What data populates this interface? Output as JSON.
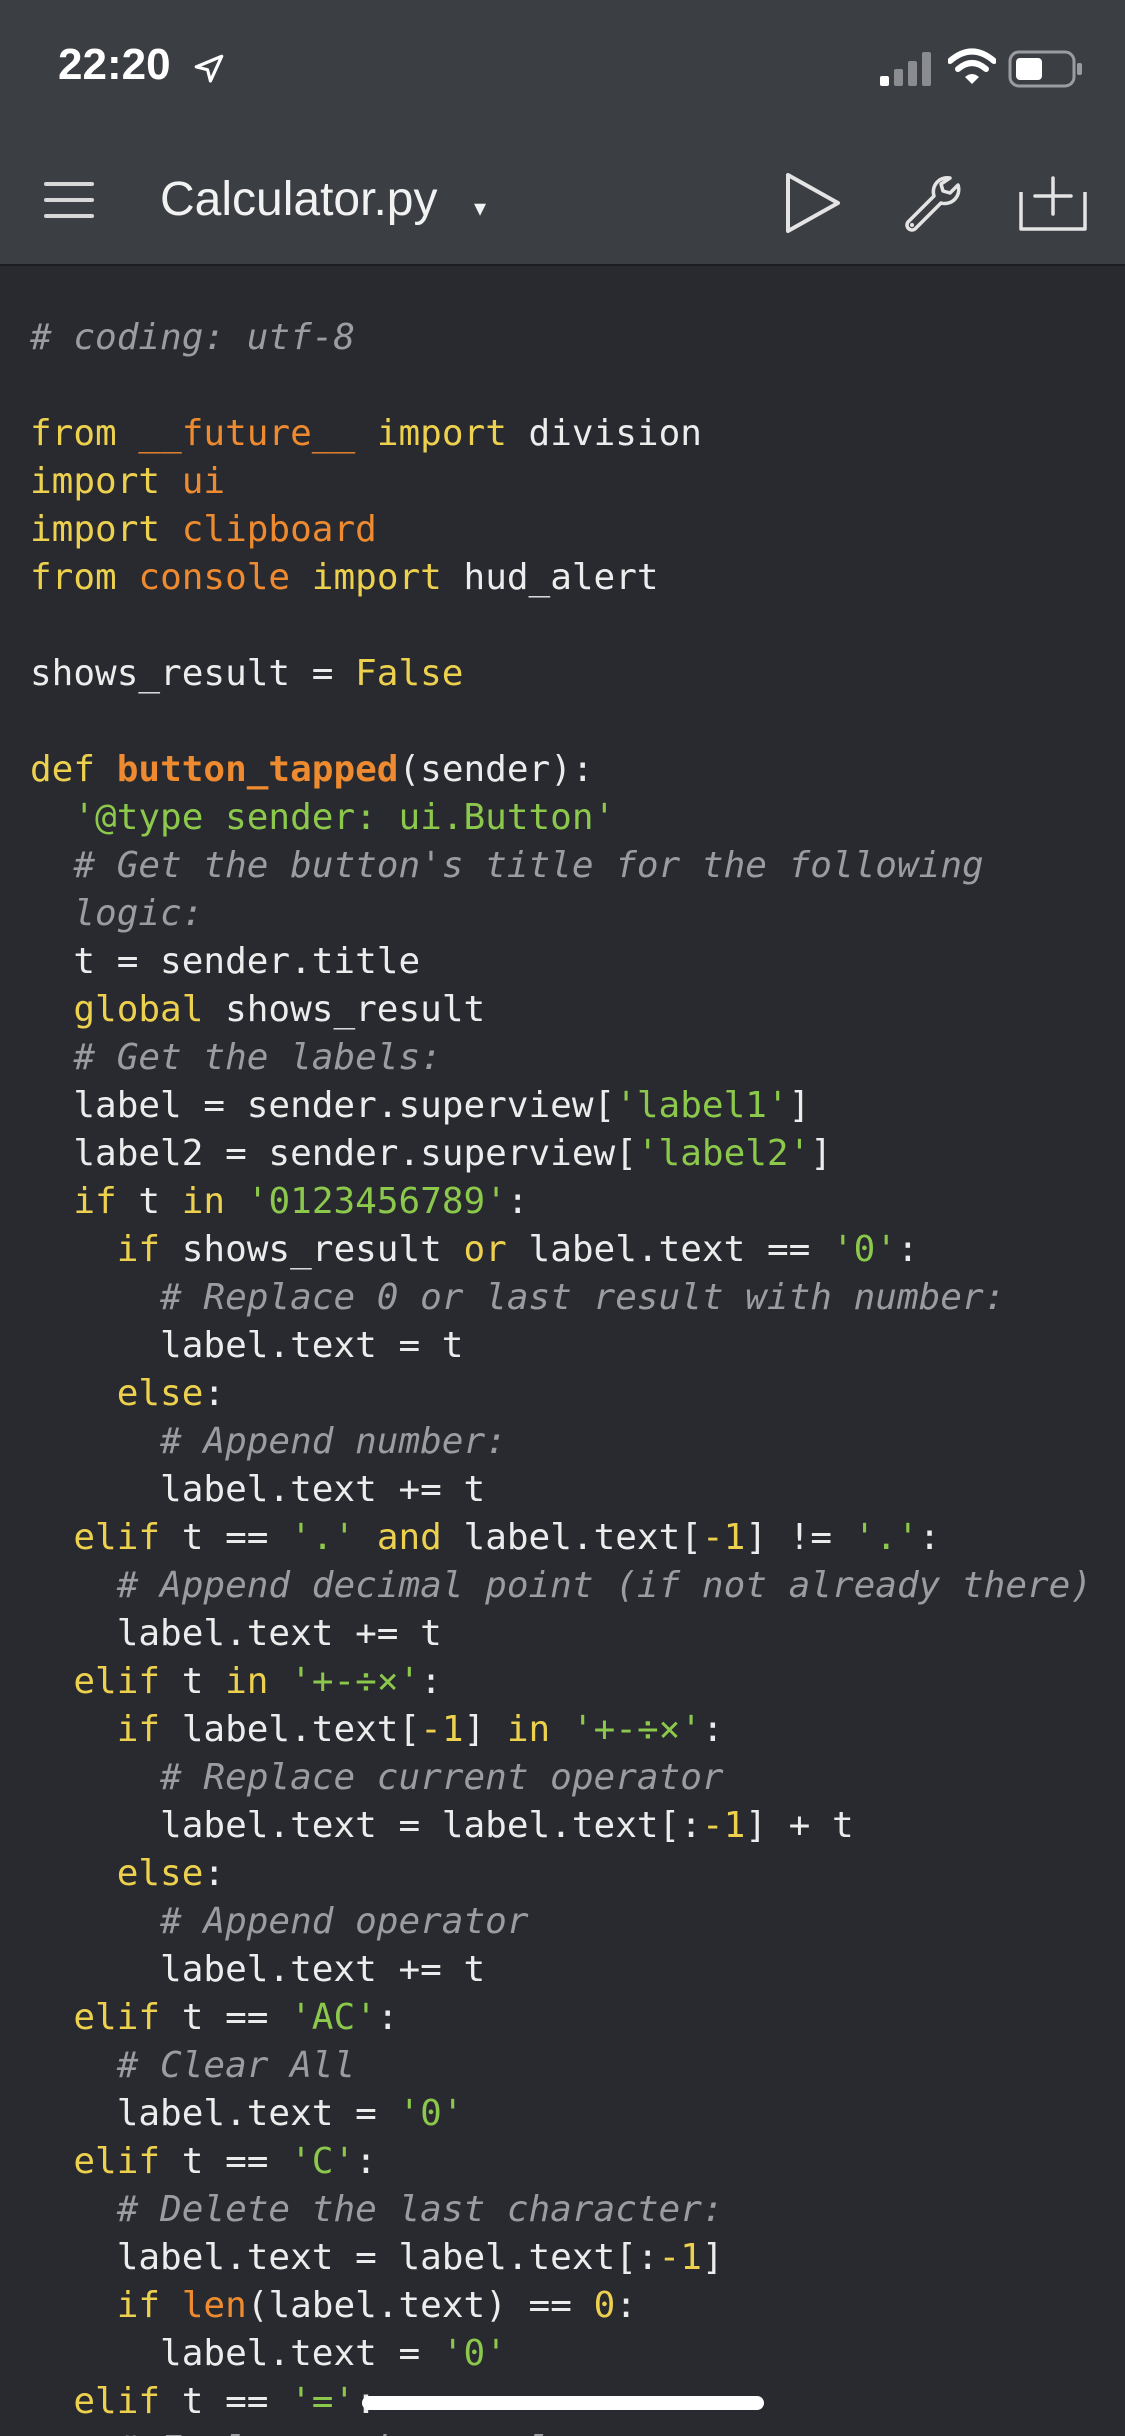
{
  "status_bar": {
    "time": "22:20",
    "icons": [
      "location-arrow-icon",
      "cellular-signal-icon",
      "wifi-icon",
      "battery-icon"
    ]
  },
  "nav_bar": {
    "title": "Calculator.py",
    "title_caret": "▾",
    "buttons": [
      "menu-icon",
      "play-icon",
      "wrench-icon",
      "add-file-icon"
    ]
  },
  "colors": {
    "background": "#282a2f",
    "bar": "#3b3e43",
    "keyword": "#ecd04e",
    "module": "#ee8a2f",
    "string": "#8cc84b",
    "comment": "#9a9ca2",
    "text": "#ececec"
  },
  "code": {
    "language": "python",
    "lines": [
      [
        [
          "c",
          "# coding: utf-8"
        ]
      ],
      [],
      [
        [
          "k",
          "from"
        ],
        [
          "t",
          " "
        ],
        [
          "m",
          "__future__"
        ],
        [
          "t",
          " "
        ],
        [
          "k",
          "import"
        ],
        [
          "t",
          " division"
        ]
      ],
      [
        [
          "k",
          "import"
        ],
        [
          "t",
          " "
        ],
        [
          "m",
          "ui"
        ]
      ],
      [
        [
          "k",
          "import"
        ],
        [
          "t",
          " "
        ],
        [
          "m",
          "clipboard"
        ]
      ],
      [
        [
          "k",
          "from"
        ],
        [
          "t",
          " "
        ],
        [
          "m",
          "console"
        ],
        [
          "t",
          " "
        ],
        [
          "k",
          "import"
        ],
        [
          "t",
          " hud_alert"
        ]
      ],
      [],
      [
        [
          "t",
          "shows_result = "
        ],
        [
          "k",
          "False"
        ]
      ],
      [],
      [
        [
          "k",
          "def"
        ],
        [
          "t",
          " "
        ],
        [
          "f",
          "button_tapped"
        ],
        [
          "t",
          "(sender):"
        ]
      ],
      [
        [
          "t",
          "  "
        ],
        [
          "s",
          "'@type sender: ui.Button'"
        ]
      ],
      [
        [
          "t",
          "  "
        ],
        [
          "c",
          "# Get the button's title for the following"
        ]
      ],
      [
        [
          "t",
          "  "
        ],
        [
          "c",
          "logic:"
        ]
      ],
      [
        [
          "t",
          "  t = sender.title"
        ]
      ],
      [
        [
          "t",
          "  "
        ],
        [
          "k",
          "global"
        ],
        [
          "t",
          " shows_result"
        ]
      ],
      [
        [
          "t",
          "  "
        ],
        [
          "c",
          "# Get the labels:"
        ]
      ],
      [
        [
          "t",
          "  label = sender.superview["
        ],
        [
          "s",
          "'label1'"
        ],
        [
          "t",
          "]"
        ]
      ],
      [
        [
          "t",
          "  label2 = sender.superview["
        ],
        [
          "s",
          "'label2'"
        ],
        [
          "t",
          "]"
        ]
      ],
      [
        [
          "t",
          "  "
        ],
        [
          "k",
          "if"
        ],
        [
          "t",
          " t "
        ],
        [
          "k",
          "in"
        ],
        [
          "t",
          " "
        ],
        [
          "s",
          "'0123456789'"
        ],
        [
          "t",
          ":"
        ]
      ],
      [
        [
          "t",
          "    "
        ],
        [
          "k",
          "if"
        ],
        [
          "t",
          " shows_result "
        ],
        [
          "k",
          "or"
        ],
        [
          "t",
          " label.text == "
        ],
        [
          "s",
          "'0'"
        ],
        [
          "t",
          ":"
        ]
      ],
      [
        [
          "t",
          "      "
        ],
        [
          "c",
          "# Replace 0 or last result with number:"
        ]
      ],
      [
        [
          "t",
          "      label.text = t"
        ]
      ],
      [
        [
          "t",
          "    "
        ],
        [
          "k",
          "else"
        ],
        [
          "t",
          ":"
        ]
      ],
      [
        [
          "t",
          "      "
        ],
        [
          "c",
          "# Append number:"
        ]
      ],
      [
        [
          "t",
          "      label.text += t"
        ]
      ],
      [
        [
          "t",
          "  "
        ],
        [
          "k",
          "elif"
        ],
        [
          "t",
          " t == "
        ],
        [
          "s",
          "'.'"
        ],
        [
          "t",
          " "
        ],
        [
          "k",
          "and"
        ],
        [
          "t",
          " label.text["
        ],
        [
          "n",
          "-1"
        ],
        [
          "t",
          "] != "
        ],
        [
          "s",
          "'.'"
        ],
        [
          "t",
          ":"
        ]
      ],
      [
        [
          "t",
          "    "
        ],
        [
          "c",
          "# Append decimal point (if not already there)"
        ]
      ],
      [
        [
          "t",
          "    label.text += t"
        ]
      ],
      [
        [
          "t",
          "  "
        ],
        [
          "k",
          "elif"
        ],
        [
          "t",
          " t "
        ],
        [
          "k",
          "in"
        ],
        [
          "t",
          " "
        ],
        [
          "s",
          "'+-÷×'"
        ],
        [
          "t",
          ":"
        ]
      ],
      [
        [
          "t",
          "    "
        ],
        [
          "k",
          "if"
        ],
        [
          "t",
          " label.text["
        ],
        [
          "n",
          "-1"
        ],
        [
          "t",
          "] "
        ],
        [
          "k",
          "in"
        ],
        [
          "t",
          " "
        ],
        [
          "s",
          "'+-÷×'"
        ],
        [
          "t",
          ":"
        ]
      ],
      [
        [
          "t",
          "      "
        ],
        [
          "c",
          "# Replace current operator"
        ]
      ],
      [
        [
          "t",
          "      label.text = label.text[:"
        ],
        [
          "n",
          "-1"
        ],
        [
          "t",
          "] + t"
        ]
      ],
      [
        [
          "t",
          "    "
        ],
        [
          "k",
          "else"
        ],
        [
          "t",
          ":"
        ]
      ],
      [
        [
          "t",
          "      "
        ],
        [
          "c",
          "# Append operator"
        ]
      ],
      [
        [
          "t",
          "      label.text += t"
        ]
      ],
      [
        [
          "t",
          "  "
        ],
        [
          "k",
          "elif"
        ],
        [
          "t",
          " t == "
        ],
        [
          "s",
          "'AC'"
        ],
        [
          "t",
          ":"
        ]
      ],
      [
        [
          "t",
          "    "
        ],
        [
          "c",
          "# Clear All"
        ]
      ],
      [
        [
          "t",
          "    label.text = "
        ],
        [
          "s",
          "'0'"
        ]
      ],
      [
        [
          "t",
          "  "
        ],
        [
          "k",
          "elif"
        ],
        [
          "t",
          " t == "
        ],
        [
          "s",
          "'C'"
        ],
        [
          "t",
          ":"
        ]
      ],
      [
        [
          "t",
          "    "
        ],
        [
          "c",
          "# Delete the last character:"
        ]
      ],
      [
        [
          "t",
          "    label.text = label.text[:"
        ],
        [
          "n",
          "-1"
        ],
        [
          "t",
          "]"
        ]
      ],
      [
        [
          "t",
          "    "
        ],
        [
          "k",
          "if"
        ],
        [
          "t",
          " "
        ],
        [
          "b",
          "len"
        ],
        [
          "t",
          "(label.text) == "
        ],
        [
          "n",
          "0"
        ],
        [
          "t",
          ":"
        ]
      ],
      [
        [
          "t",
          "      label.text = "
        ],
        [
          "s",
          "'0'"
        ]
      ],
      [
        [
          "t",
          "  "
        ],
        [
          "k",
          "elif"
        ],
        [
          "t",
          " t == "
        ],
        [
          "s",
          "'='"
        ],
        [
          "t",
          ":"
        ]
      ],
      [
        [
          "t",
          "    "
        ],
        [
          "c",
          "# Evaluate the result:"
        ]
      ]
    ]
  }
}
